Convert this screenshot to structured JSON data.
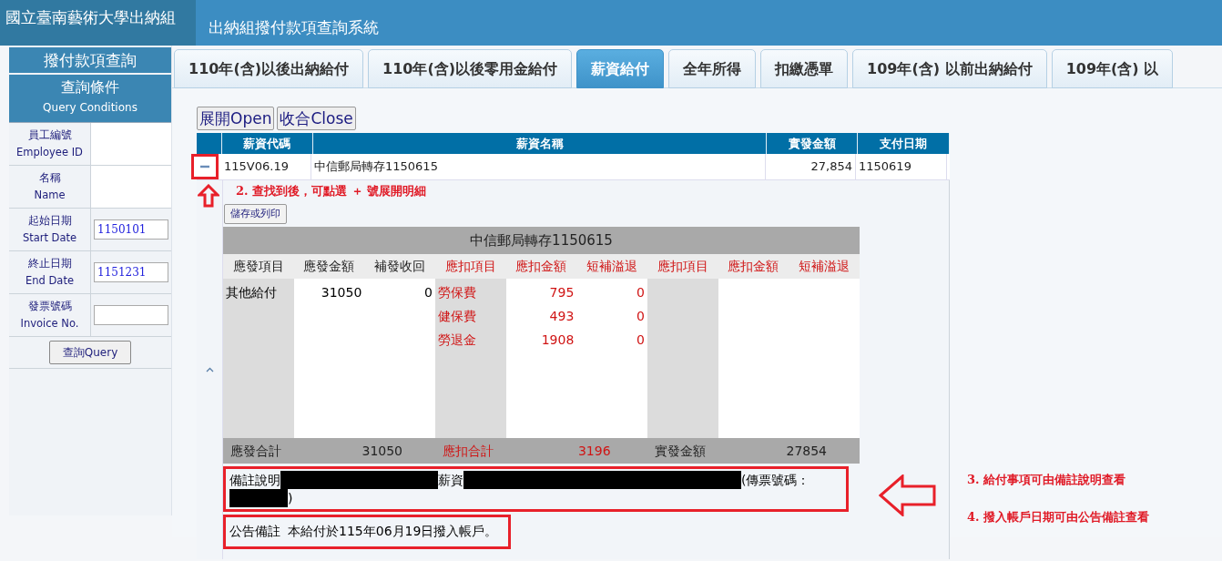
{
  "header": {
    "school": "國立臺南藝術大學出納組",
    "system": "出納組撥付款項查詢系統"
  },
  "sidebar": {
    "title": "撥付款項查詢",
    "section": {
      "title": "查詢條件",
      "subtitle": "Query Conditions"
    },
    "fields": [
      {
        "label": "員工編號",
        "label_en": "Employee ID",
        "kind": "blank"
      },
      {
        "label": "名稱",
        "label_en": "Name",
        "kind": "blank"
      },
      {
        "label": "起始日期",
        "label_en": "Start Date",
        "kind": "input",
        "value": "1150101"
      },
      {
        "label": "終止日期",
        "label_en": "End Date",
        "kind": "input",
        "value": "1151231"
      },
      {
        "label": "發票號碼",
        "label_en": "Invoice No.",
        "kind": "input"
      }
    ],
    "query_button": "查詢Query"
  },
  "tabs": [
    {
      "label": "110年(含)以後出納給付",
      "selected": false
    },
    {
      "label": "110年(含)以後零用金給付",
      "selected": false
    },
    {
      "label": "薪資給付",
      "selected": true
    },
    {
      "label": "全年所得",
      "selected": false
    },
    {
      "label": "扣繳憑單",
      "selected": false
    },
    {
      "label": "109年(含) 以前出納給付",
      "selected": false
    },
    {
      "label": "109年(含) 以",
      "selected": false
    }
  ],
  "toolbar": {
    "buttons": [
      "展開Open",
      "收合Close"
    ]
  },
  "table": {
    "columns": [
      "薪資代碼",
      "薪資名稱",
      "實發金額",
      "支付日期"
    ],
    "rows": [
      {
        "expanded": true,
        "cells": [
          "115V06.19",
          "中信郵局轉存1150615",
          "27,854",
          "1150619"
        ],
        "detail": {
          "print_button": "儲存或列印",
          "title": "中信郵局轉存1150615",
          "headers": [
            {
              "label": "應發項目",
              "kind": "earning"
            },
            {
              "label": "應發金額",
              "kind": "earning"
            },
            {
              "label": "補發收回",
              "kind": "earning"
            },
            {
              "label": "應扣項目",
              "kind": "deduction"
            },
            {
              "label": "應扣金額",
              "kind": "deduction"
            },
            {
              "label": "短補溢退",
              "kind": "deduction"
            },
            {
              "label": "應扣項目",
              "kind": "deduction"
            },
            {
              "label": "應扣金額",
              "kind": "deduction"
            },
            {
              "label": "短補溢退",
              "kind": "deduction"
            }
          ],
          "earnings": [
            {
              "item": "其他給付",
              "amount": "31050",
              "adjust": "0"
            }
          ],
          "deductions": [
            {
              "item": "勞保費",
              "amount": "795",
              "adjust": "0"
            },
            {
              "item": "健保費",
              "amount": "493",
              "adjust": "0"
            },
            {
              "item": "勞退金",
              "amount": "1908",
              "adjust": "0"
            }
          ],
          "summary": [
            {
              "label": "應發合計",
              "value": "31050",
              "kind": "earning"
            },
            {
              "label": "應扣合計",
              "value": "3196",
              "kind": "deduction"
            },
            {
              "label": "實發金額",
              "value": "27854",
              "kind": "net"
            }
          ],
          "remark": {
            "label": "備註說明",
            "parts": [
              {
                "kind": "redacted"
              },
              {
                "kind": "text",
                "text": "薪資"
              },
              {
                "kind": "redacted"
              },
              {
                "kind": "text",
                "text": "(傳票號碼："
              },
              {
                "kind": "redacted"
              },
              {
                "kind": "text",
                "text": ")"
              }
            ]
          },
          "notice": {
            "label": "公告備註",
            "text": "本給付於115年06月19日撥入帳戶。"
          }
        }
      }
    ]
  },
  "annotations": [
    {
      "text": "2. 查找到後，可點選 ＋ 號展開明細"
    },
    {
      "text": "3. 給付事項可由備註說明查看"
    },
    {
      "text": "4. 撥入帳戶日期可由公告備註查看"
    }
  ]
}
